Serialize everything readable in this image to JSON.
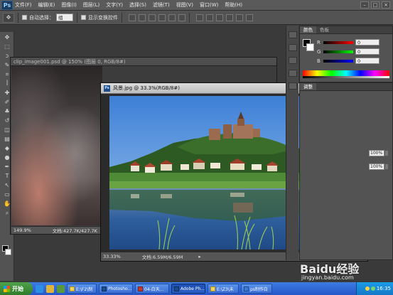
{
  "app": {
    "logo": "Ps"
  },
  "menubar": {
    "items": [
      "文件(F)",
      "编辑(E)",
      "图像(I)",
      "图层(L)",
      "文字(Y)",
      "选择(S)",
      "滤镜(T)",
      "视图(V)",
      "窗口(W)",
      "帮助(H)"
    ],
    "window_controls": [
      "–",
      "□",
      "×"
    ]
  },
  "options_bar": {
    "auto_select_label": "自动选择：",
    "auto_select_value": "组",
    "show_transform_label": "显示变换控件"
  },
  "toolbar": {
    "tools": [
      "move-icon",
      "marquee-icon",
      "lasso-icon",
      "quick-select-icon",
      "crop-icon",
      "eyedropper-icon",
      "healing-icon",
      "brush-icon",
      "stamp-icon",
      "history-brush-icon",
      "eraser-icon",
      "gradient-icon",
      "blur-icon",
      "dodge-icon",
      "pen-icon",
      "type-icon",
      "path-select-icon",
      "shape-icon",
      "hand-icon",
      "zoom-icon"
    ],
    "glyphs": [
      "✥",
      "⬚",
      "ↄ",
      "✎",
      "⌗",
      "ꟾ",
      "✚",
      "✐",
      "♣",
      "↺",
      "◫",
      "▤",
      "◆",
      "●",
      "✒",
      "T",
      "↖",
      "▭",
      "✋",
      "⌕"
    ]
  },
  "color_panel": {
    "tabs": [
      "颜色",
      "色板"
    ],
    "channels": [
      {
        "label": "R",
        "value": "0"
      },
      {
        "label": "G",
        "value": "0"
      },
      {
        "label": "B",
        "value": "0"
      }
    ]
  },
  "panel2": {
    "tab": "调整",
    "values": [
      "100%",
      "100%"
    ]
  },
  "bg_document": {
    "title": "clip_image001.psd @ 150% (图层 0, RGB/8#)",
    "zoom": "149.9%",
    "doc_size": "文档:427.7K/427.7K"
  },
  "front_document": {
    "icon": "Ps",
    "title": "风景.jpg @ 33.3%(RGB/8#)",
    "zoom": "33.33%",
    "doc_size": "文档:6.59M/6.59M"
  },
  "taskbar": {
    "start": "开始",
    "tasks": [
      {
        "label": "E:\\F2\\制",
        "active": false
      },
      {
        "label": "Photosho...",
        "active": false
      },
      {
        "label": "04-白天...",
        "active": false
      },
      {
        "label": "Adobe Ph...",
        "active": true
      },
      {
        "label": "E:\\Z3\\未",
        "active": false
      },
      {
        "label": "ps制作白",
        "active": false
      }
    ],
    "clock": "16:35"
  },
  "watermark": {
    "main": "Baidu经验",
    "sub": "jingyan.baidu.com"
  }
}
